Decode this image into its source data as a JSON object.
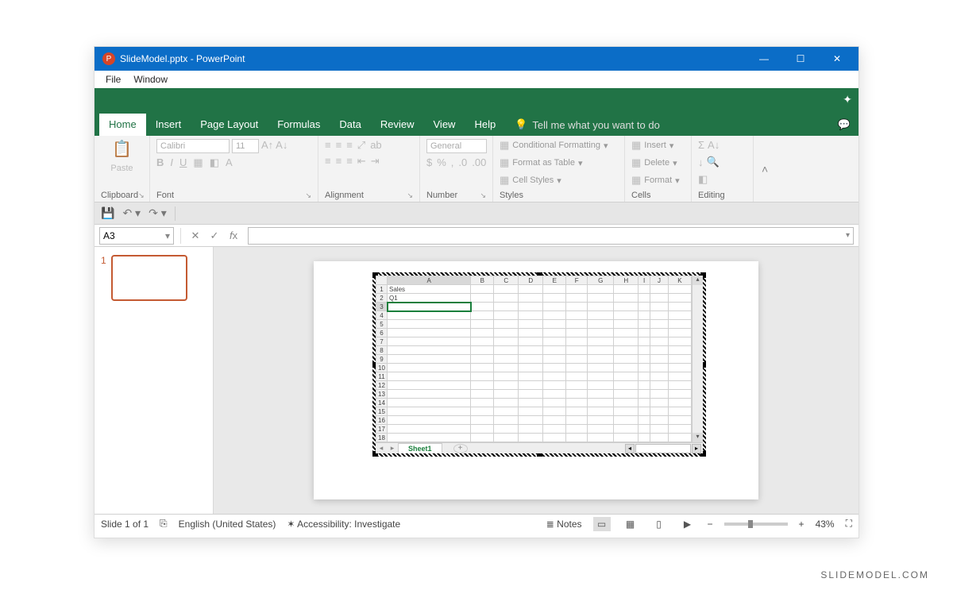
{
  "titlebar": {
    "title": "SlideModel.pptx - PowerPoint"
  },
  "menubar": {
    "file": "File",
    "window": "Window"
  },
  "tabs": {
    "home": "Home",
    "insert": "Insert",
    "pagelayout": "Page Layout",
    "formulas": "Formulas",
    "data": "Data",
    "review": "Review",
    "view": "View",
    "help": "Help",
    "tellme": "Tell me what you want to do"
  },
  "ribbon": {
    "clipboard": {
      "label": "Clipboard",
      "paste": "Paste"
    },
    "font": {
      "label": "Font",
      "name": "Calibri",
      "size": "11"
    },
    "alignment": {
      "label": "Alignment"
    },
    "number": {
      "label": "Number",
      "format": "General"
    },
    "styles": {
      "label": "Styles",
      "cf": "Conditional Formatting",
      "fat": "Format as Table",
      "cs": "Cell Styles"
    },
    "cells": {
      "label": "Cells",
      "insert": "Insert",
      "delete": "Delete",
      "format": "Format"
    },
    "editing": {
      "label": "Editing"
    }
  },
  "namebox": "A3",
  "thumb": {
    "num": "1"
  },
  "spreadsheet": {
    "columns": [
      "A",
      "B",
      "C",
      "D",
      "E",
      "F",
      "G",
      "H",
      "I",
      "J",
      "K"
    ],
    "rows": 18,
    "cells": {
      "A1": "Sales",
      "A2": "Q1"
    },
    "selected": "A3",
    "sheet_tab": "Sheet1"
  },
  "statusbar": {
    "slide": "Slide 1 of 1",
    "lang": "English (United States)",
    "acc": "Accessibility: Investigate",
    "notes": "Notes",
    "zoom": "43%"
  },
  "watermark": "SLIDEMODEL.COM"
}
